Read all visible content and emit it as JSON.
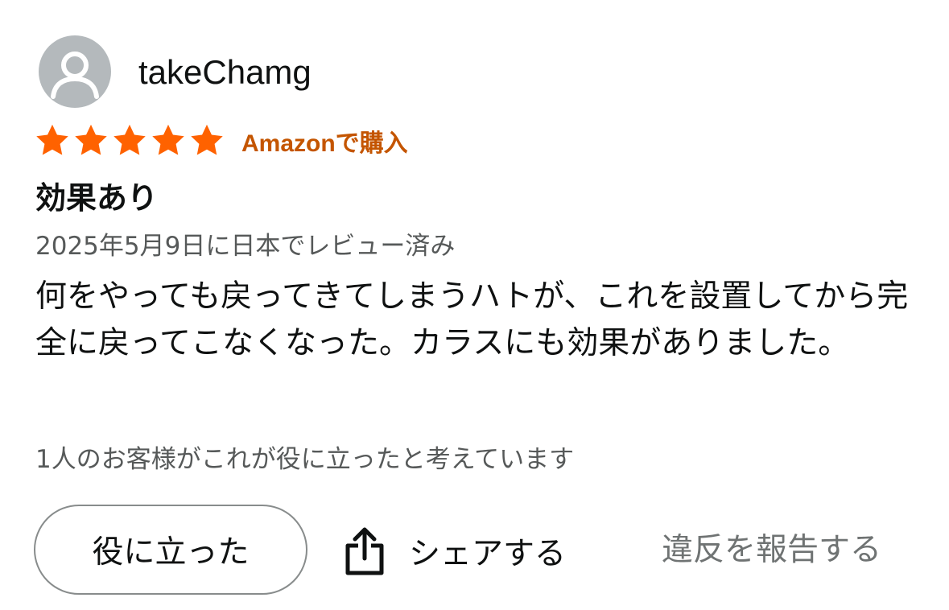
{
  "review": {
    "author": "takeChamg",
    "rating": 5,
    "rating_max": 5,
    "badge": "Amazonで購入",
    "title": "効果あり",
    "meta": "2025年5月9日に日本でレビュー済み",
    "body": "何をやっても戻ってきてしまうハトが、これを設置してから完全に戻ってこなくなった。カラスにも効果がありました。",
    "helpful_count_text": "1人のお客様がこれが役に立ったと考えています"
  },
  "actions": {
    "helpful_label": "役に立った",
    "share_label": "シェアする",
    "report_label": "違反を報告する"
  },
  "colors": {
    "star": "#ff6200",
    "badge": "#c45500",
    "avatar_bg": "#b4b9bc",
    "secondary_text": "#565959"
  },
  "icons": {
    "avatar": "person-icon",
    "star": "star-icon",
    "share": "share-icon"
  }
}
